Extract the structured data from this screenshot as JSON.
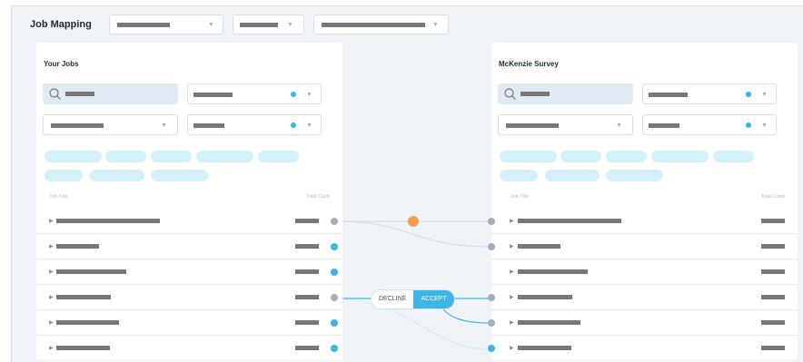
{
  "page": {
    "title": "Job Mapping"
  },
  "colors": {
    "accent": "#3db5e6",
    "highlight": "#f5a04c",
    "pill": "#d3f1fa",
    "node_grey": "#a3adbd"
  },
  "left_panel": {
    "title": "Your Jobs",
    "col_job_title": "Job Title",
    "col_total_cash": "Total Cash"
  },
  "right_panel": {
    "title": "McKenzie Survey",
    "col_job_title": "Job Title",
    "col_total_cash": "Total Cash"
  },
  "decision": {
    "decline": "DECLINE",
    "accept": "ACCEPT"
  },
  "icons": {
    "search": "search-icon",
    "dropdown": "chevron-down-icon",
    "expand": "caret-right-icon"
  }
}
